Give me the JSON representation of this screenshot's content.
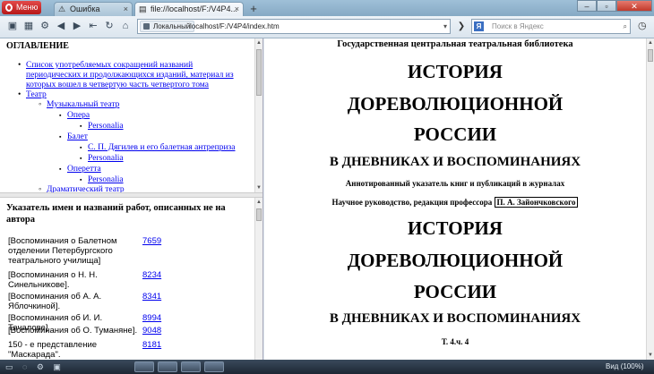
{
  "browser": {
    "menu_label": "Меню",
    "tabs": [
      {
        "label": "Ошибка",
        "active": false
      },
      {
        "label": "file://localhost/F:/V4P4...",
        "active": true
      }
    ],
    "new_tab": "+",
    "address": {
      "badge": "Локальный",
      "url": "localhost/F:/V4P4/index.htm"
    },
    "search_placeholder": "Поиск в Яндекс",
    "status_zoom": "Вид (100%)"
  },
  "toc": {
    "title": "ОГЛАВЛЕНИЕ",
    "items": [
      "Список употребляемых сокращений названий периодических и продолжающихся изданий, материал из которых вошел в четвертую часть четвертого тома",
      "Театр",
      "Музыкальный театр",
      "Опера",
      "Personalia",
      "Балет",
      "С. П. Дягилев и его балетная антреприза",
      "Personalia",
      "Оперетта",
      "Personalia",
      "Драматический театр"
    ]
  },
  "index": {
    "title": "Указатель имен и названий работ, описанных не на автора",
    "rows": [
      {
        "name": "[Воспоминания о Балетном отделении Петербургского театрального училища]",
        "num": "7659"
      },
      {
        "name": "[Воспоминания о Н. Н. Синельникове].",
        "num": "8234"
      },
      {
        "name": "[Воспоминания об А. А. Яблочкиной].",
        "num": "8341"
      },
      {
        "name": "[Воспоминания об И. И. Тачалове]",
        "num": "8994"
      },
      {
        "name": "[Воспоминания об О. Туманяне].",
        "num": "9048"
      },
      {
        "name": "150 - е представление \"Маскарада\".",
        "num": "8181"
      }
    ]
  },
  "doc": {
    "library": "Государственная центральная театральная библиотека",
    "title_lines": [
      "ИСТОРИЯ",
      "ДОРЕВОЛЮЦИОННОЙ",
      "РОССИИ"
    ],
    "subtitle": "В ДНЕВНИКАХ И ВОСПОМИНАНИЯХ",
    "annot": "Аннотированный указатель книг и публикаций в журналах",
    "lead_prefix": "Научное руководство, редакция профессора",
    "lead_name": "П. А. Зайончковского",
    "title2_lines": [
      "ИСТОРИЯ",
      "ДОРЕВОЛЮЦИОННОЙ",
      "РОССИИ"
    ],
    "subtitle2": "В ДНЕВНИКАХ И ВОСПОМИНАНИЯХ",
    "volume": "Т. 4.ч. 4"
  }
}
